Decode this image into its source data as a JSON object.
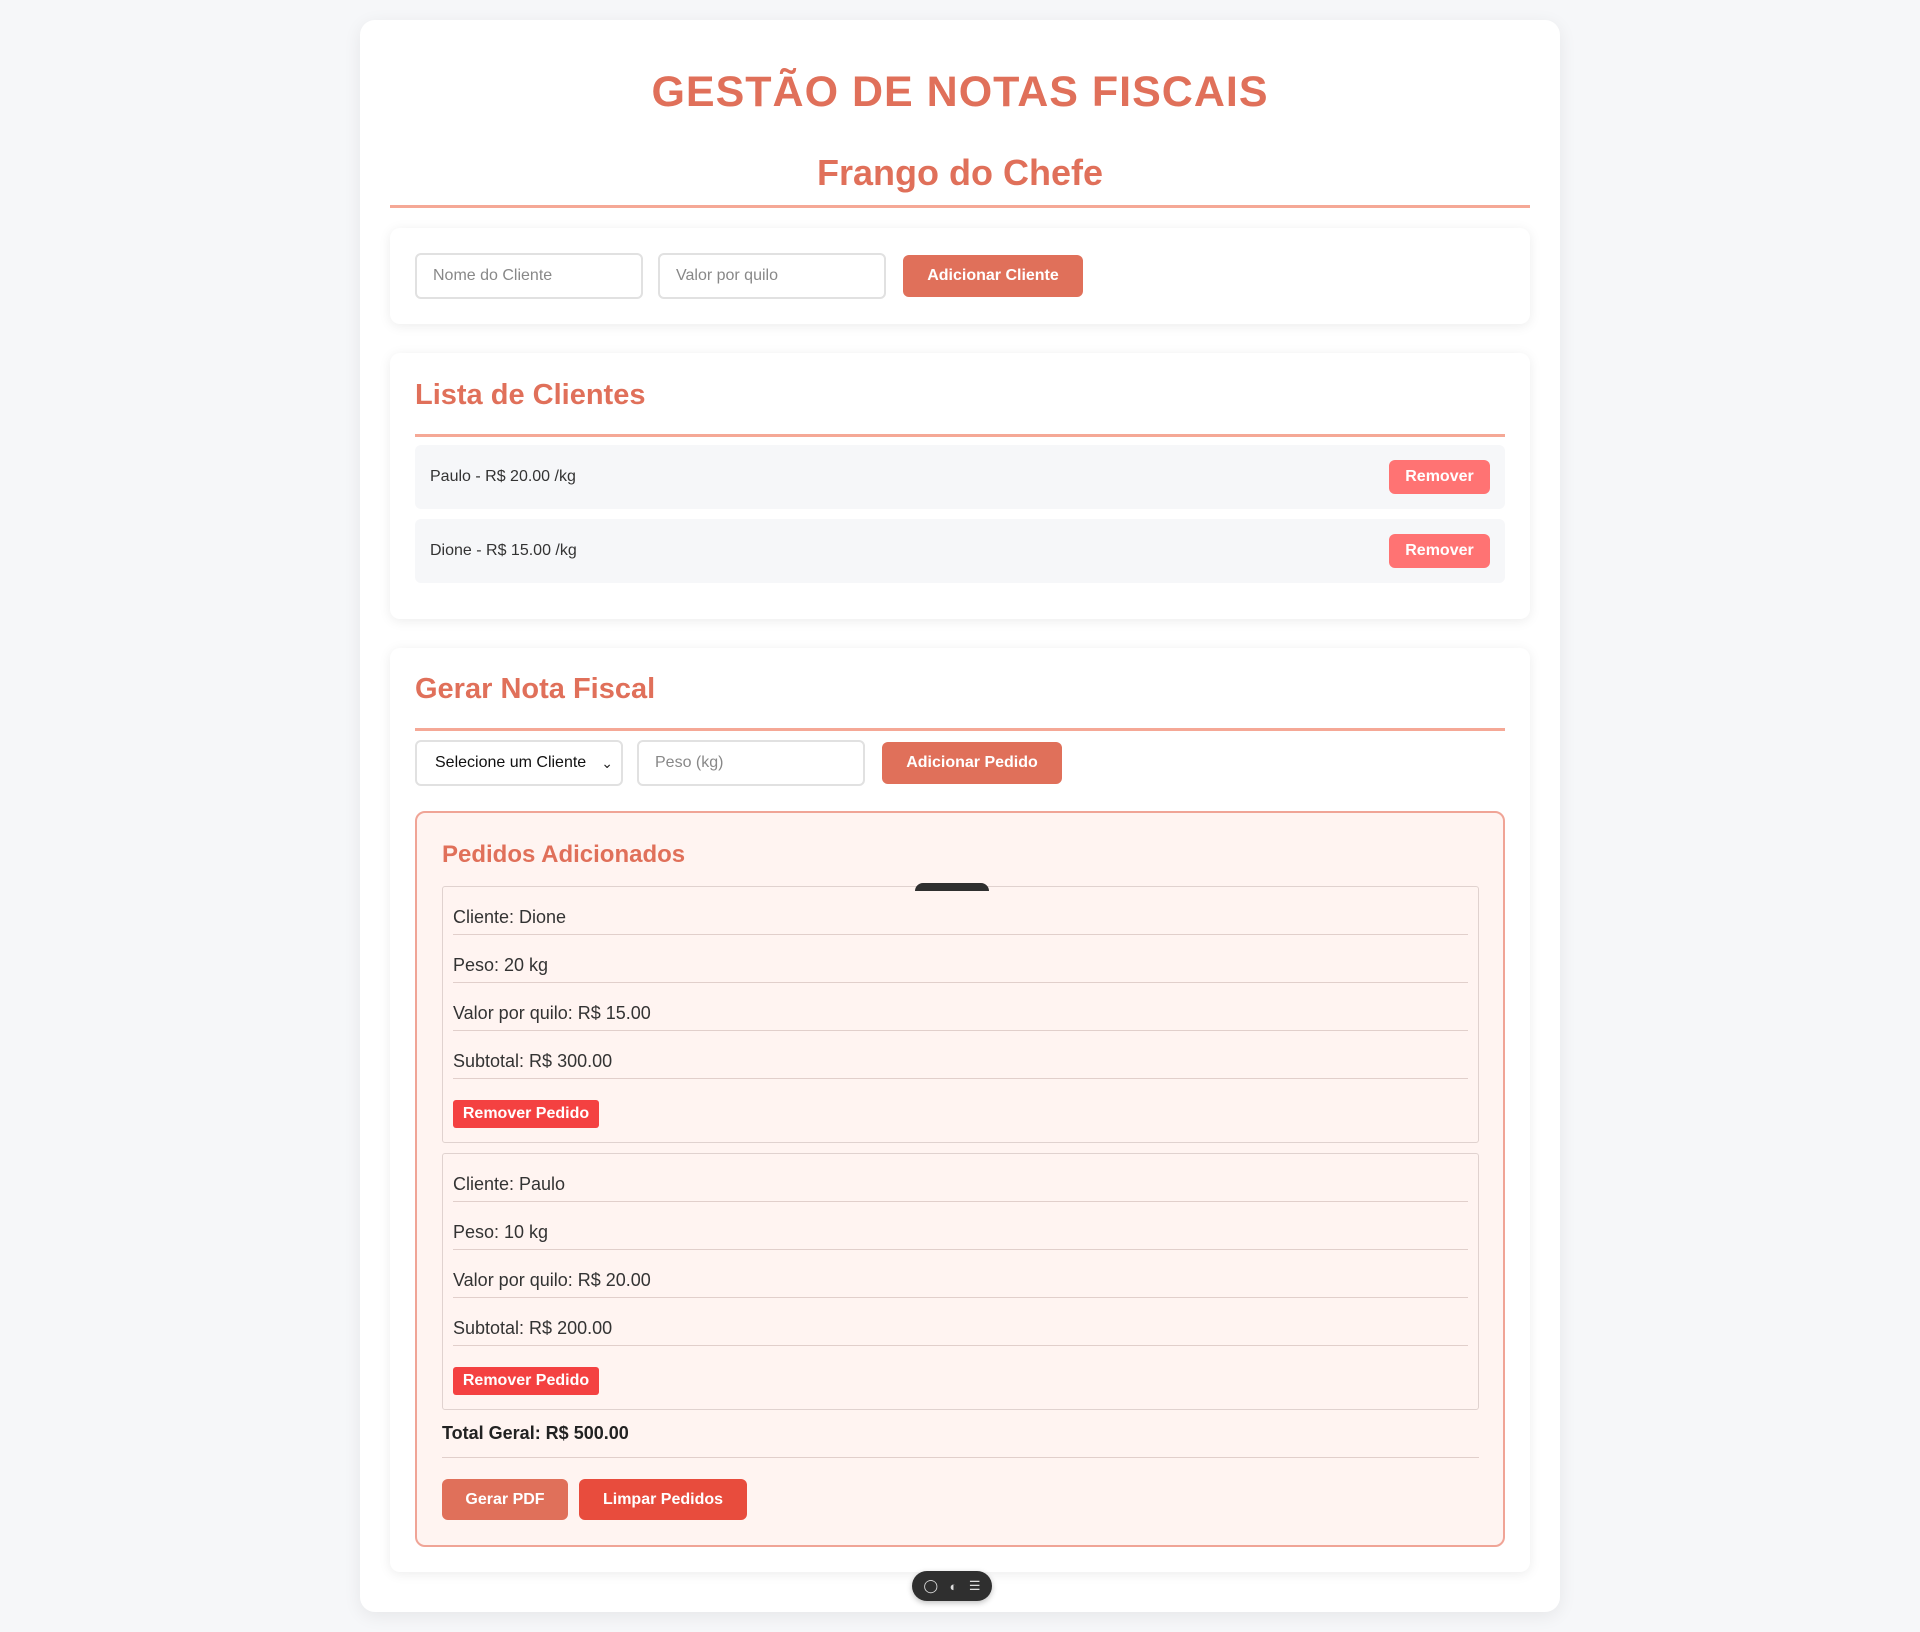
{
  "header": {
    "title": "GESTÃO DE NOTAS FISCAIS",
    "subtitle": "Frango do Chefe"
  },
  "add_client": {
    "name_placeholder": "Nome do Cliente",
    "price_placeholder": "Valor por quilo",
    "button_label": "Adicionar Cliente"
  },
  "client_list": {
    "title": "Lista de Clientes",
    "items": [
      {
        "label": "Paulo - R$ 20.00 /kg",
        "remove_label": "Remover"
      },
      {
        "label": "Dione - R$ 15.00 /kg",
        "remove_label": "Remover"
      }
    ]
  },
  "invoice": {
    "title": "Gerar Nota Fiscal",
    "select_value": "Selecione um Cliente",
    "weight_placeholder": "Peso (kg)",
    "add_button_label": "Adicionar Pedido",
    "orders_title": "Pedidos Adicionados",
    "orders": [
      {
        "client": "Cliente: Dione",
        "weight": "Peso: 20 kg",
        "price": "Valor por quilo: R$ 15.00",
        "subtotal": "Subtotal: R$ 300.00",
        "remove_label": "Remover Pedido"
      },
      {
        "client": "Cliente: Paulo",
        "weight": "Peso: 10 kg",
        "price": "Valor por quilo: R$ 20.00",
        "subtotal": "Subtotal: R$ 200.00",
        "remove_label": "Remover Pedido"
      }
    ],
    "total": "Total Geral: R$ 500.00",
    "pdf_button_label": "Gerar PDF",
    "clear_button_label": "Limpar Pedidos"
  },
  "toolbar": {
    "icons": [
      "chat-icon",
      "toggle-icon",
      "settings-icon"
    ]
  },
  "colors": {
    "accent": "#e0705a",
    "accent_light": "#f5a896",
    "remove": "#ff7373",
    "remove_order": "#f44141",
    "clear": "#e84c3d",
    "orders_bg": "#fff4f1"
  }
}
